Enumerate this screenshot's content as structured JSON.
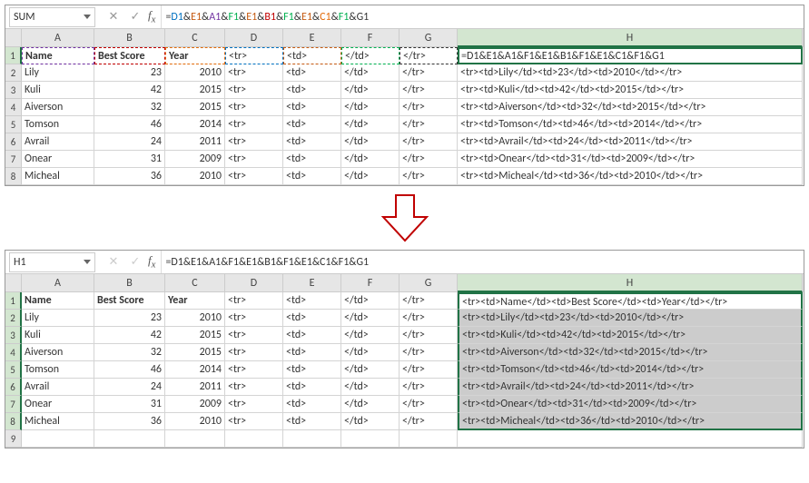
{
  "top": {
    "nameBox": "SUM",
    "formulaColored": [
      {
        "t": "=",
        "c": ""
      },
      {
        "t": "D1",
        "c": "seg-d"
      },
      {
        "t": "&",
        "c": ""
      },
      {
        "t": "E1",
        "c": "seg-e"
      },
      {
        "t": "&",
        "c": ""
      },
      {
        "t": "A1",
        "c": "seg-a"
      },
      {
        "t": "&",
        "c": ""
      },
      {
        "t": "F1",
        "c": "seg-f"
      },
      {
        "t": "&",
        "c": ""
      },
      {
        "t": "E1",
        "c": "seg-e"
      },
      {
        "t": "&",
        "c": ""
      },
      {
        "t": "B1",
        "c": "seg-b"
      },
      {
        "t": "&",
        "c": ""
      },
      {
        "t": "F1",
        "c": "seg-f"
      },
      {
        "t": "&",
        "c": ""
      },
      {
        "t": "E1",
        "c": "seg-e"
      },
      {
        "t": "&",
        "c": ""
      },
      {
        "t": "C1",
        "c": "seg-c"
      },
      {
        "t": "&",
        "c": ""
      },
      {
        "t": "F1",
        "c": "seg-f"
      },
      {
        "t": "&",
        "c": ""
      },
      {
        "t": "G1",
        "c": "seg-g"
      }
    ],
    "cols": [
      "A",
      "B",
      "C",
      "D",
      "E",
      "F",
      "G",
      "H"
    ],
    "rows": [
      {
        "n": "1",
        "A": "Name",
        "B": "Best Score",
        "C": "Year",
        "D": "<tr>",
        "E": "<td>",
        "F": "</td>",
        "G": "</tr>",
        "H": "=D1&E1&A1&F1&E1&B1&F1&E1&C1&F1&G1"
      },
      {
        "n": "2",
        "A": "Lily",
        "B": "23",
        "C": "2010",
        "D": "<tr>",
        "E": "<td>",
        "F": "</td>",
        "G": "</tr>",
        "H": "<tr><td>Lily</td><td>23</td><td>2010</td></tr>"
      },
      {
        "n": "3",
        "A": "Kuli",
        "B": "42",
        "C": "2015",
        "D": "<tr>",
        "E": "<td>",
        "F": "</td>",
        "G": "</tr>",
        "H": "<tr><td>Kuli</td><td>42</td><td>2015</td></tr>"
      },
      {
        "n": "4",
        "A": "Aiverson",
        "B": "32",
        "C": "2015",
        "D": "<tr>",
        "E": "<td>",
        "F": "</td>",
        "G": "</tr>",
        "H": "<tr><td>Aiverson</td><td>32</td><td>2015</td></tr>"
      },
      {
        "n": "5",
        "A": "Tomson",
        "B": "46",
        "C": "2014",
        "D": "<tr>",
        "E": "<td>",
        "F": "</td>",
        "G": "</tr>",
        "H": "<tr><td>Tomson</td><td>46</td><td>2014</td></tr>"
      },
      {
        "n": "6",
        "A": "Avrail",
        "B": "24",
        "C": "2011",
        "D": "<tr>",
        "E": "<td>",
        "F": "</td>",
        "G": "</tr>",
        "H": "<tr><td>Avrail</td><td>24</td><td>2011</td></tr>"
      },
      {
        "n": "7",
        "A": "Onear",
        "B": "31",
        "C": "2009",
        "D": "<tr>",
        "E": "<td>",
        "F": "</td>",
        "G": "</tr>",
        "H": "<tr><td>Onear</td><td>31</td><td>2009</td></tr>"
      },
      {
        "n": "8",
        "A": "Micheal",
        "B": "36",
        "C": "2010",
        "D": "<tr>",
        "E": "<td>",
        "F": "</td>",
        "G": "</tr>",
        "H": "<tr><td>Micheal</td><td>36</td><td>2010</td></tr>"
      }
    ]
  },
  "bottom": {
    "nameBox": "H1",
    "formulaPlain": "=D1&E1&A1&F1&E1&B1&F1&E1&C1&F1&G1",
    "cols": [
      "A",
      "B",
      "C",
      "D",
      "E",
      "F",
      "G",
      "H"
    ],
    "rows": [
      {
        "n": "1",
        "A": "Name",
        "B": "Best Score",
        "C": "Year",
        "D": "<tr>",
        "E": "<td>",
        "F": "</td>",
        "G": "</tr>",
        "H": "<tr><td>Name</td><td>Best Score</td><td>Year</td></tr>"
      },
      {
        "n": "2",
        "A": "Lily",
        "B": "23",
        "C": "2010",
        "D": "<tr>",
        "E": "<td>",
        "F": "</td>",
        "G": "</tr>",
        "H": "<tr><td>Lily</td><td>23</td><td>2010</td></tr>"
      },
      {
        "n": "3",
        "A": "Kuli",
        "B": "42",
        "C": "2015",
        "D": "<tr>",
        "E": "<td>",
        "F": "</td>",
        "G": "</tr>",
        "H": "<tr><td>Kuli</td><td>42</td><td>2015</td></tr>"
      },
      {
        "n": "4",
        "A": "Aiverson",
        "B": "32",
        "C": "2015",
        "D": "<tr>",
        "E": "<td>",
        "F": "</td>",
        "G": "</tr>",
        "H": "<tr><td>Aiverson</td><td>32</td><td>2015</td></tr>"
      },
      {
        "n": "5",
        "A": "Tomson",
        "B": "46",
        "C": "2014",
        "D": "<tr>",
        "E": "<td>",
        "F": "</td>",
        "G": "</tr>",
        "H": "<tr><td>Tomson</td><td>46</td><td>2014</td></tr>"
      },
      {
        "n": "6",
        "A": "Avrail",
        "B": "24",
        "C": "2011",
        "D": "<tr>",
        "E": "<td>",
        "F": "</td>",
        "G": "</tr>",
        "H": "<tr><td>Avrail</td><td>24</td><td>2011</td></tr>"
      },
      {
        "n": "7",
        "A": "Onear",
        "B": "31",
        "C": "2009",
        "D": "<tr>",
        "E": "<td>",
        "F": "</td>",
        "G": "</tr>",
        "H": "<tr><td>Onear</td><td>31</td><td>2009</td></tr>"
      },
      {
        "n": "8",
        "A": "Micheal",
        "B": "36",
        "C": "2010",
        "D": "<tr>",
        "E": "<td>",
        "F": "</td>",
        "G": "</tr>",
        "H": "<tr><td>Micheal</td><td>36</td><td>2010</td></tr>"
      },
      {
        "n": "9",
        "A": "",
        "B": "",
        "C": "",
        "D": "",
        "E": "",
        "F": "",
        "G": "",
        "H": ""
      }
    ]
  }
}
